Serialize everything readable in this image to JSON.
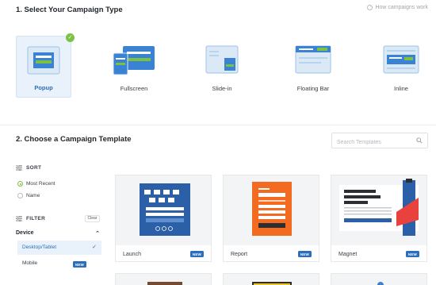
{
  "section1": {
    "title": "1. Select Your Campaign Type",
    "help_link": "How campaigns work"
  },
  "campaign_types": [
    {
      "label": "Popup",
      "icon": "popup-icon",
      "selected": true
    },
    {
      "label": "Fullscreen",
      "icon": "fullscreen-icon",
      "selected": false
    },
    {
      "label": "Slide-in",
      "icon": "slide-in-icon",
      "selected": false
    },
    {
      "label": "Floating Bar",
      "icon": "floating-bar-icon",
      "selected": false
    },
    {
      "label": "Inline",
      "icon": "inline-icon",
      "selected": false
    }
  ],
  "section2": {
    "title": "2. Choose a Campaign Template",
    "search_placeholder": "Search Templates"
  },
  "sidebar": {
    "sort_heading": "SORT",
    "sort_options": [
      {
        "label": "Most Recent",
        "checked": true
      },
      {
        "label": "Name",
        "checked": false
      }
    ],
    "filter_heading": "FILTER",
    "clear_label": "Clear",
    "device_heading": "Device",
    "device_options": [
      {
        "label": "Desktop/Tablet",
        "selected": true,
        "badge": ""
      },
      {
        "label": "Mobile",
        "selected": false,
        "badge": "NEW"
      }
    ]
  },
  "templates": [
    {
      "name": "Launch",
      "badge": "NEW"
    },
    {
      "name": "Report",
      "badge": "NEW"
    },
    {
      "name": "Magnet",
      "badge": "NEW"
    }
  ],
  "colors": {
    "accent_blue": "#2a6ebd",
    "check_green": "#7cc242",
    "report_orange": "#f26b21",
    "magnet_red": "#e8413e"
  }
}
